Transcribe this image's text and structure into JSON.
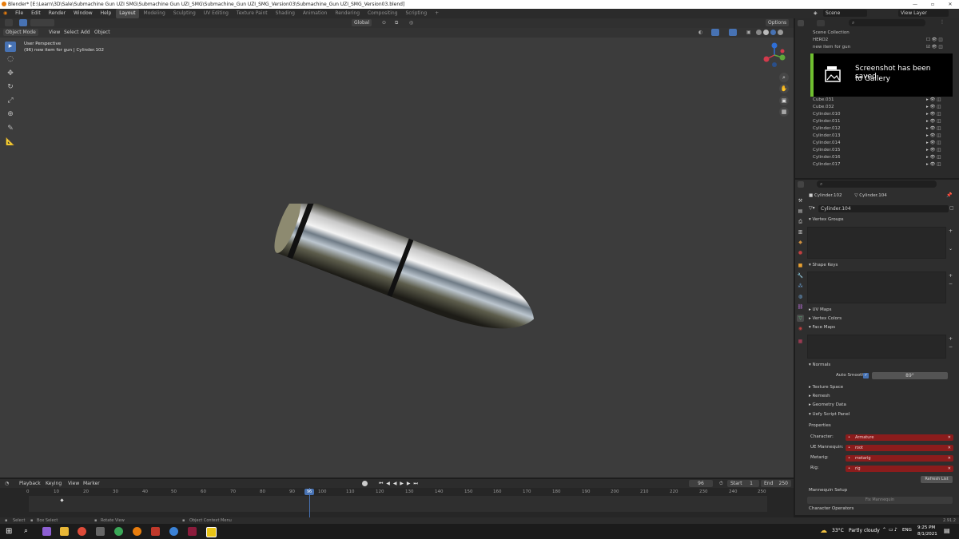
{
  "window": {
    "title": "Blender* [E:\\Learn\\3D\\Sale\\Submachine Gun UZI SMG\\Submachine Gun UZI_SMG\\Submachine_Gun UZI_SMG_Version03\\Submachine_Gun UZI_SMG_Version03.blend]",
    "min": "—",
    "max": "▫",
    "close": "✕"
  },
  "menubar": {
    "items": [
      "File",
      "Edit",
      "Render",
      "Window",
      "Help"
    ],
    "workspaces": [
      "Layout",
      "Modeling",
      "Sculpting",
      "UV Editing",
      "Texture Paint",
      "Shading",
      "Animation",
      "Rendering",
      "Compositing",
      "Scripting"
    ],
    "add_tab": "+",
    "scene": "Scene",
    "view_layer": "View Layer"
  },
  "viewport": {
    "mode": "Object Mode",
    "menus": [
      "View",
      "Select",
      "Add",
      "Object"
    ],
    "transform": "Global",
    "options": "Options",
    "overlay_title": "User Perspective",
    "overlay_sub": "(96) new item for gun | Cylinder.102",
    "gizmo": {
      "x": "X",
      "y": "Y",
      "z": "Z"
    }
  },
  "timeline": {
    "menus": [
      "Playback",
      "Keying",
      "View",
      "Marker"
    ],
    "current_frame": "96",
    "start_label": "Start",
    "start": "1",
    "end_label": "End",
    "end": "250",
    "ticks": [
      "0",
      "10",
      "20",
      "30",
      "40",
      "50",
      "60",
      "70",
      "80",
      "90",
      "100",
      "110",
      "120",
      "130",
      "140",
      "150",
      "160",
      "170",
      "180",
      "190",
      "200",
      "210",
      "220",
      "230",
      "240",
      "250"
    ],
    "marker": "96"
  },
  "statusbar": {
    "select": "Select",
    "box_select": "Box Select",
    "rotate_view": "Rotate View",
    "context_menu": "Object Context Menu",
    "version": "2.91.2"
  },
  "outliner": {
    "search_placeholder": "",
    "root": "Scene Collection",
    "rows": [
      "HERO2",
      "new item for gun",
      "Cube.031",
      "Cube.032",
      "Cylinder.010",
      "Cylinder.011",
      "Cylinder.012",
      "Cylinder.013",
      "Cylinder.014",
      "Cylinder.015",
      "Cylinder.016",
      "Cylinder.017"
    ]
  },
  "toast": {
    "line1": "Screenshot has been saved",
    "line2": "to Gallery"
  },
  "properties": {
    "object": "Cylinder.102",
    "mesh": "Cylinder.104",
    "mesh_field": "Cylinder.104",
    "sections": {
      "vertex_groups": "Vertex Groups",
      "shape_keys": "Shape Keys",
      "uv_maps": "UV Maps",
      "vertex_colors": "Vertex Colors",
      "face_maps": "Face Maps",
      "normals": "Normals",
      "texture_space": "Texture Space",
      "remesh": "Remesh",
      "geometry_data": "Geometry Data",
      "uefy": "Uefy Script Panel",
      "properties": "Properties",
      "mannequin_setup": "Mannequin Setup",
      "character_operators": "Character Operators"
    },
    "auto_smooth": "Auto Smooth",
    "angle": "89°",
    "character_label": "Character:",
    "character": "Armature",
    "ue_label": "UE Mannequin:",
    "ue": "root",
    "metarig_label": "Metarig:",
    "metarig": "metarig",
    "rig_label": "Rig:",
    "rig": "rig",
    "refresh": "Refresh List",
    "fix_mannequin": "Fix Mannequin"
  },
  "taskbar": {
    "temp": "33°C",
    "weather": "Partly cloudy",
    "lang": "ENG",
    "time": "9:25 PM",
    "date": "8/1/2021"
  },
  "colors": {
    "accent": "#4772b3",
    "green": "#6fbf2f",
    "red_field": "#8b1c1c",
    "frame_marker": "#4772b3"
  }
}
